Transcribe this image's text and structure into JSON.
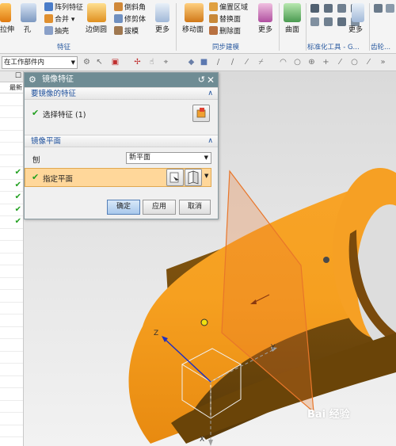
{
  "ribbon": {
    "items": [
      {
        "id": "pattern",
        "label": "阵列特征"
      },
      {
        "id": "combine",
        "label": "合并 ▾"
      },
      {
        "id": "shell",
        "label": "抽壳"
      },
      {
        "id": "chamfer",
        "label": "倒斜角"
      },
      {
        "id": "trim",
        "label": "修剪体"
      },
      {
        "id": "draft",
        "label": "拔模"
      },
      {
        "id": "offset_region",
        "label": "偏置区域"
      },
      {
        "id": "replace_face",
        "label": "替换面"
      },
      {
        "id": "delete_face",
        "label": "删除面"
      }
    ],
    "big_buttons": [
      {
        "id": "extrude",
        "label": "拉伸"
      },
      {
        "id": "hole",
        "label": "孔"
      },
      {
        "id": "edge_blend",
        "label": "边倒圆"
      },
      {
        "id": "more1",
        "label": "更多"
      },
      {
        "id": "move_face",
        "label": "移动面"
      },
      {
        "id": "more2",
        "label": "更多"
      },
      {
        "id": "surface",
        "label": "曲面"
      },
      {
        "id": "more3",
        "label": "更多"
      }
    ],
    "groups": {
      "feature": "特征",
      "sync": "同步建模",
      "std_tools": "标准化工具 - G...",
      "gear": "齿轮..."
    }
  },
  "filterbar": {
    "scope_value": "在工作部件内"
  },
  "navigator": {
    "header_icon": "☐",
    "sub_label": "最新",
    "checked_rows": [
      6,
      7,
      8,
      9,
      10
    ]
  },
  "dialog": {
    "title": "镜像特征",
    "section_feature": {
      "heading": "要镜像的特征",
      "select_label": "选择特征 (1)"
    },
    "section_plane": {
      "heading": "镜像平面",
      "method_label": "刨",
      "method_value": "新平面",
      "specify_label": "指定平面"
    },
    "buttons": {
      "ok": "确定",
      "apply": "应用",
      "cancel": "取消"
    }
  },
  "viewport": {
    "axis_x": "X",
    "axis_y": "Y",
    "axis_z": "Z",
    "watermark": "Bai 经验"
  },
  "colors": {
    "solid_orange": "#f5a020",
    "plane_orange": "#e8762a",
    "dialog_title_bg": "#6f8c94",
    "section_text": "#1c4f9c",
    "highlight_row": "#ffd79a",
    "check_green": "#22a020"
  }
}
